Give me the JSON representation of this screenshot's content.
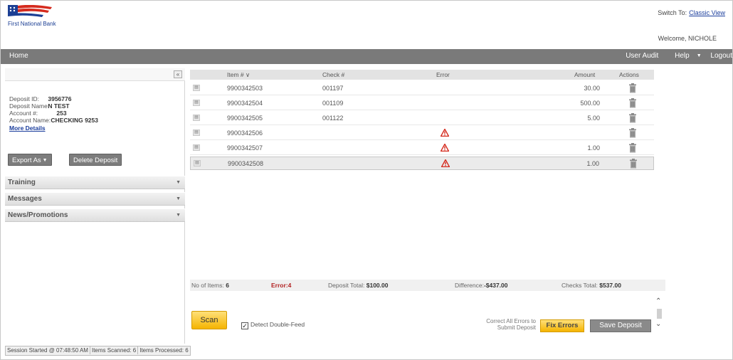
{
  "header": {
    "bank_name": "First National Bank",
    "switch_label": "Switch To:",
    "switch_link": "Classic View",
    "welcome": "Welcome, NICHOLE"
  },
  "nav": {
    "home": "Home",
    "user_audit": "User Audit",
    "help": "Help",
    "logout": "Logout"
  },
  "deposit": {
    "id_label": "Deposit ID:",
    "id_value": "3956776",
    "name_label": "Deposit Name:",
    "name_value": "N TEST",
    "account_label": "Account #:",
    "account_value": "253",
    "account_name_label": "Account Name:",
    "account_name_value": "CHECKING 9253",
    "more_details": "More Details"
  },
  "actions": {
    "export": "Export As",
    "delete": "Delete Deposit"
  },
  "accordion": [
    "Training",
    "Messages",
    "News/Promotions"
  ],
  "table": {
    "headers": {
      "item": "Item # ∨",
      "check": "Check #",
      "error": "Error",
      "amount": "Amount",
      "actions": "Actions"
    },
    "rows": [
      {
        "item": "9900342503",
        "check": "001197",
        "error": false,
        "amount": "30.00"
      },
      {
        "item": "9900342504",
        "check": "001109",
        "error": false,
        "amount": "500.00"
      },
      {
        "item": "9900342505",
        "check": "001122",
        "error": false,
        "amount": "5.00"
      },
      {
        "item": "9900342506",
        "check": "",
        "error": true,
        "amount": ""
      },
      {
        "item": "9900342507",
        "check": "",
        "error": true,
        "amount": "1.00"
      },
      {
        "item": "9900342508",
        "check": "",
        "error": true,
        "amount": "1.00"
      }
    ]
  },
  "summary": {
    "items_label": "No of Items:",
    "items_value": "6",
    "error_label": "Error:",
    "error_value": "4",
    "deposit_total_label": "Deposit Total:",
    "deposit_total_value": "$100.00",
    "difference_label": "Difference:",
    "difference_value": "-$437.00",
    "checks_total_label": "Checks Total:",
    "checks_total_value": "$537.00"
  },
  "bottom": {
    "scan": "Scan",
    "detect": "Detect Double-Feed",
    "correct_msg": "Correct All Errors to Submit Deposit",
    "fix_errors": "Fix Errors",
    "save_deposit": "Save Deposit"
  },
  "status": {
    "session": "Session Started @ 07:48:50 AM",
    "scanned": "Items Scanned: 6",
    "processed": "Items Processed: 6"
  },
  "colors": {
    "nav_bg": "#7a7a7a",
    "accent_yellow": "#f5b400",
    "link_blue": "#1a3d9c",
    "error_red": "#d52b1e"
  }
}
